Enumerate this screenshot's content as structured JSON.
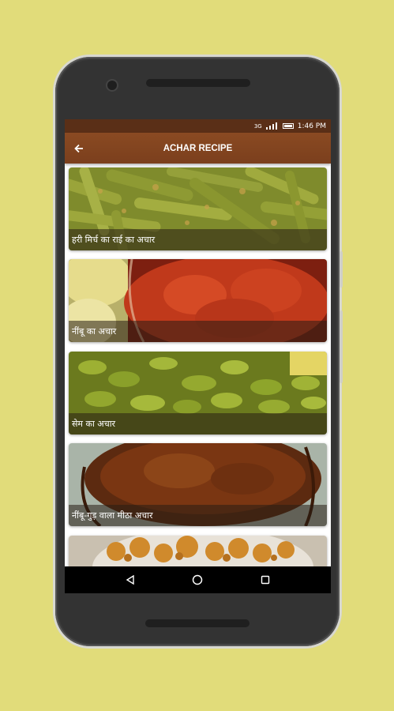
{
  "status_bar": {
    "time": "1:46 PM",
    "network_label": "3G"
  },
  "app_bar": {
    "title": "ACHAR RECIPE",
    "back_icon": "back-arrow-icon"
  },
  "recipes": [
    {
      "name": "हरी मिर्च का राई का अचार",
      "image": "green-chili-pickle"
    },
    {
      "name": "नींबू का अचार",
      "image": "lemon-pickle"
    },
    {
      "name": "सेम का अचार",
      "image": "bean-pickle"
    },
    {
      "name": "नींबू-गुड़ वाला मीठा अचार",
      "image": "sweet-lemon-jaggery-pickle"
    },
    {
      "name": "",
      "image": "cauliflower-pickle"
    }
  ],
  "nav_bar": {
    "back": "nav-back-icon",
    "home": "nav-home-icon",
    "recents": "nav-recents-icon"
  },
  "colors": {
    "background": "#e1dc7a",
    "app_bar": "#7b3f1d",
    "status_bar": "#5a2f17"
  }
}
